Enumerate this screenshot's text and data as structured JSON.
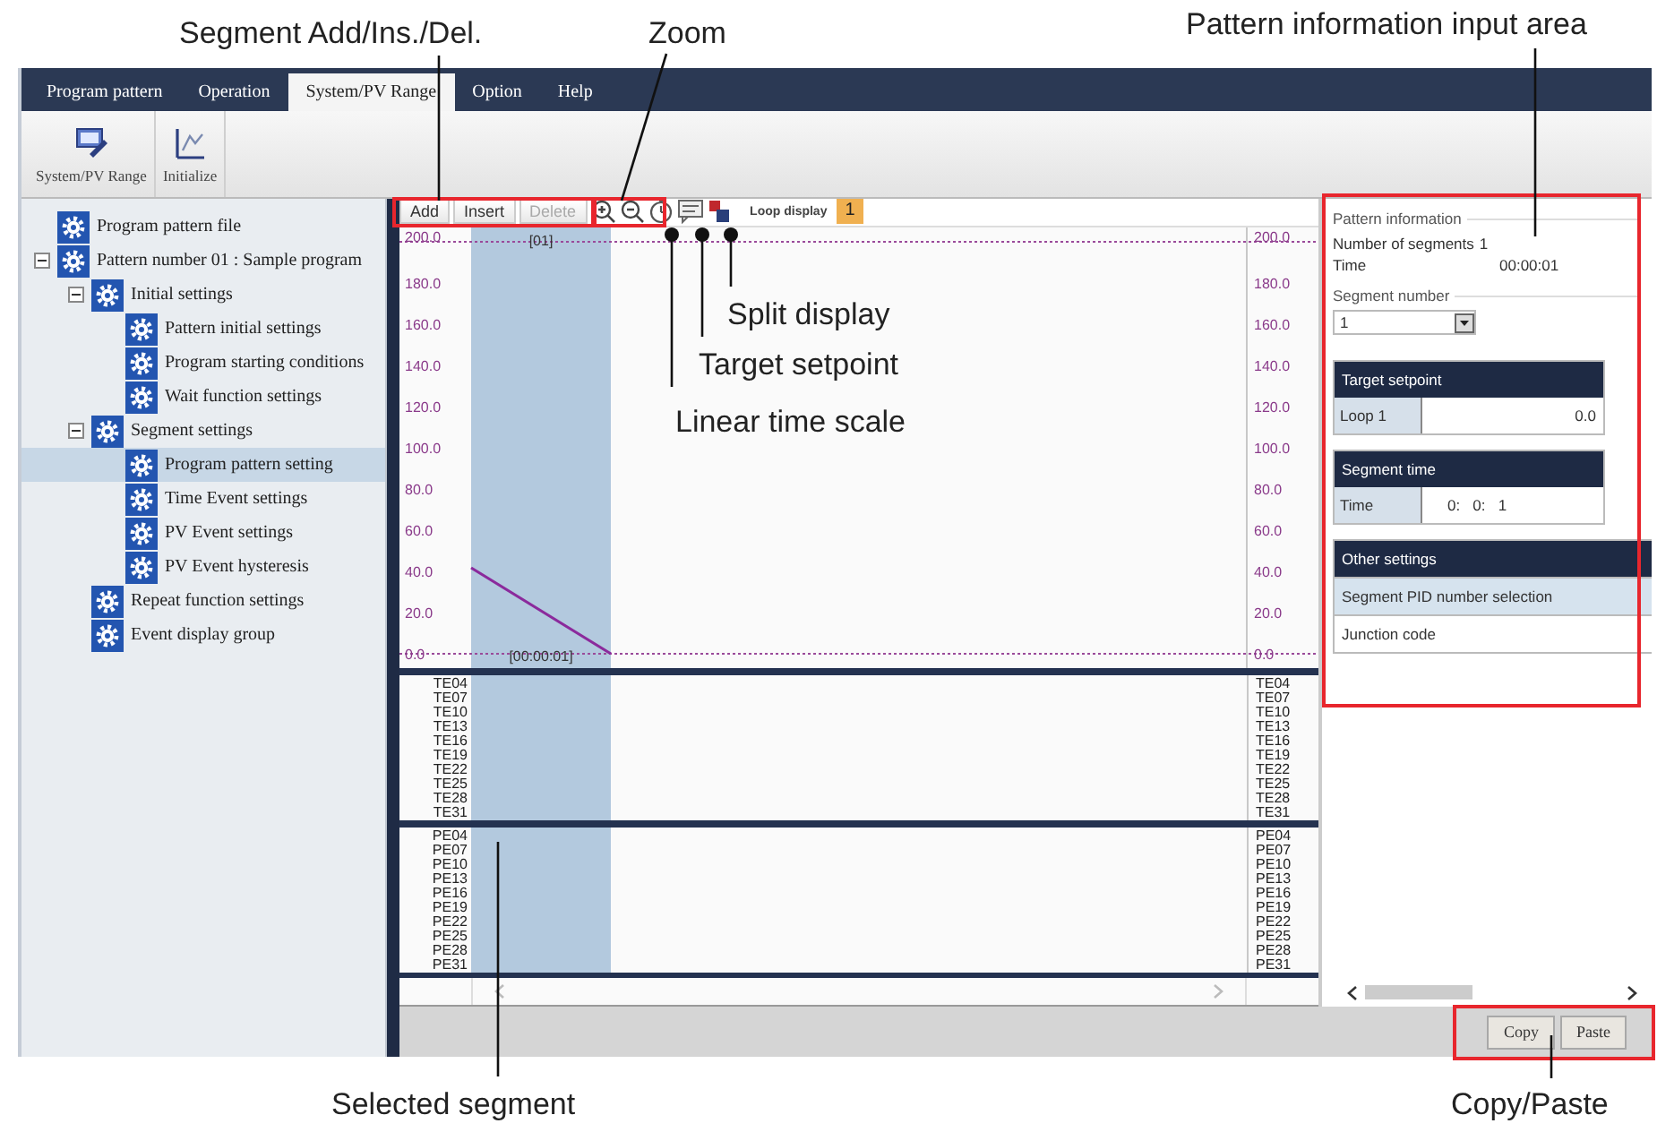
{
  "menu_tabs": [
    {
      "label": "Program pattern",
      "selected": false
    },
    {
      "label": "Operation",
      "selected": false
    },
    {
      "label": "System/PV Range",
      "selected": true
    },
    {
      "label": "Option",
      "selected": false
    },
    {
      "label": "Help",
      "selected": false
    }
  ],
  "ribbon_buttons": [
    {
      "label": "System/PV Range",
      "kind": "system"
    },
    {
      "label": "Initialize",
      "kind": "initialize"
    }
  ],
  "tree": [
    {
      "label": "Program pattern file",
      "selected": false
    },
    {
      "label": "Pattern number 01 : Sample program",
      "selected": false,
      "expanded": true,
      "children": [
        {
          "label": "Initial settings",
          "selected": false,
          "expanded": true,
          "children": [
            {
              "label": "Pattern initial settings",
              "selected": false
            },
            {
              "label": "Program starting conditions",
              "selected": false
            },
            {
              "label": "Wait function settings",
              "selected": false
            }
          ]
        },
        {
          "label": "Segment settings",
          "selected": false,
          "expanded": true,
          "children": [
            {
              "label": "Program pattern setting",
              "selected": true
            },
            {
              "label": "Time Event settings",
              "selected": false
            },
            {
              "label": "PV Event settings",
              "selected": false
            },
            {
              "label": "PV Event hysteresis",
              "selected": false
            }
          ]
        },
        {
          "label": "Repeat function settings",
          "selected": false
        },
        {
          "label": "Event display group",
          "selected": false
        }
      ]
    }
  ],
  "segment_toolbar": {
    "buttons": [
      {
        "label": "Add",
        "disabled": false
      },
      {
        "label": "Insert",
        "disabled": false
      },
      {
        "label": "Delete",
        "disabled": true
      }
    ],
    "loop_display_label": "Loop display",
    "loop_number": "1"
  },
  "chart": {
    "segment_label": "[01]",
    "time_label": "[00:00:01]",
    "left_axis_labels": [
      "200.0",
      "180.0",
      "160.0",
      "140.0",
      "120.0",
      "100.0",
      "80.0",
      "60.0",
      "40.0",
      "20.0",
      "0.0"
    ],
    "right_axis_labels": [
      "200.0",
      "180.0",
      "160.0",
      "140.0",
      "120.0",
      "100.0",
      "80.0",
      "60.0",
      "40.0",
      "20.0",
      "0.0"
    ]
  },
  "time_events": {
    "left_labels": [
      "TE04",
      "TE07",
      "TE10",
      "TE13",
      "TE16",
      "TE19",
      "TE22",
      "TE25",
      "TE28",
      "TE31"
    ],
    "right_labels": [
      "TE04",
      "TE07",
      "TE10",
      "TE13",
      "TE16",
      "TE19",
      "TE22",
      "TE25",
      "TE28",
      "TE31"
    ]
  },
  "pv_events": {
    "left_labels": [
      "PE04",
      "PE07",
      "PE10",
      "PE13",
      "PE16",
      "PE19",
      "PE22",
      "PE25",
      "PE28",
      "PE31"
    ],
    "right_labels": [
      "PE04",
      "PE07",
      "PE10",
      "PE13",
      "PE16",
      "PE19",
      "PE22",
      "PE25",
      "PE28",
      "PE31"
    ]
  },
  "pattern_info": {
    "title": "Pattern information",
    "segments_label": "Number of segments",
    "segments_value": "1",
    "time_label": "Time",
    "time_value": "00:00:01",
    "segment_number_label": "Segment number",
    "segment_number_value": "1"
  },
  "target_setpoint": {
    "title": "Target setpoint",
    "label": "Loop 1",
    "value": "0.0"
  },
  "segment_time": {
    "title": "Segment time",
    "label": "Time",
    "value": "0:   0:   1"
  },
  "other_settings": {
    "title": "Other settings",
    "items": [
      {
        "label": "Segment PID number selection",
        "selected": true
      },
      {
        "label": "Junction code",
        "selected": false
      }
    ]
  },
  "bottom_buttons": [
    "Copy",
    "Paste"
  ],
  "callouts": [
    "Segment Add/Ins./Del.",
    "Zoom",
    "Pattern information input area",
    "Split display",
    "Target setpoint",
    "Linear time scale",
    "Selected segment",
    "Copy/Paste"
  ]
}
